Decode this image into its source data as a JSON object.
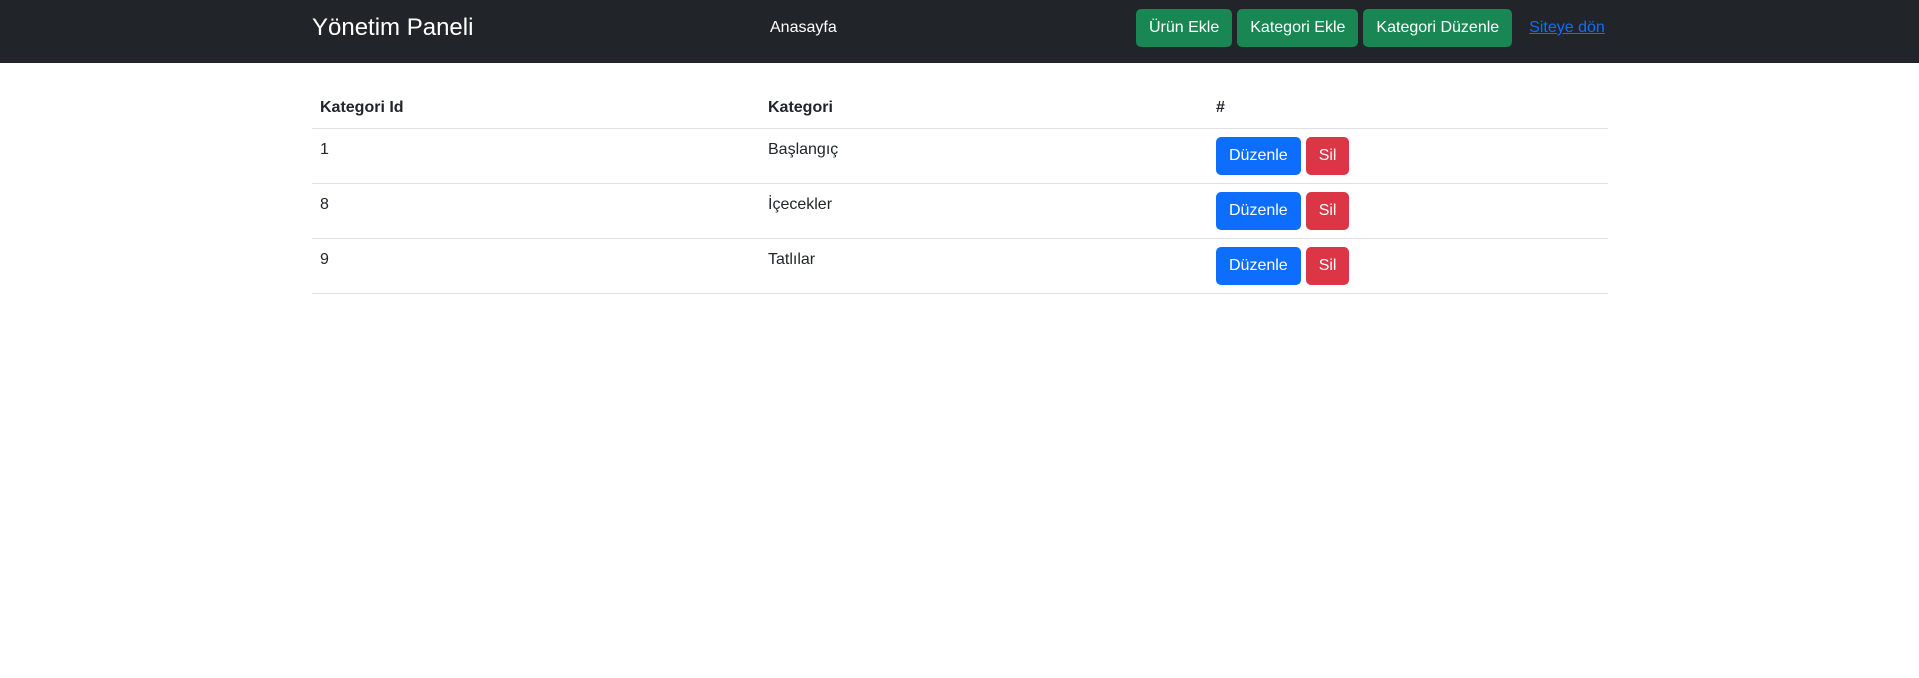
{
  "navbar": {
    "brand": "Yönetim Paneli",
    "home_link": "Anasayfa",
    "actions": {
      "add_product": "Ürün Ekle",
      "add_category": "Kategori Ekle",
      "edit_category": "Kategori Düzenle"
    },
    "back_link": "Siteye dön"
  },
  "table": {
    "headers": {
      "id": "Kategori Id",
      "category": "Kategori",
      "actions": "#"
    },
    "rows": [
      {
        "id": "1",
        "category": "Başlangıç",
        "edit_label": "Düzenle",
        "delete_label": "Sil"
      },
      {
        "id": "8",
        "category": "İçecekler",
        "edit_label": "Düzenle",
        "delete_label": "Sil"
      },
      {
        "id": "9",
        "category": "Tatlılar",
        "edit_label": "Düzenle",
        "delete_label": "Sil"
      }
    ]
  },
  "colors": {
    "navbar_bg": "#212529",
    "success": "#198754",
    "primary": "#0d6efd",
    "danger": "#dc3545",
    "link": "#0d6efd"
  }
}
